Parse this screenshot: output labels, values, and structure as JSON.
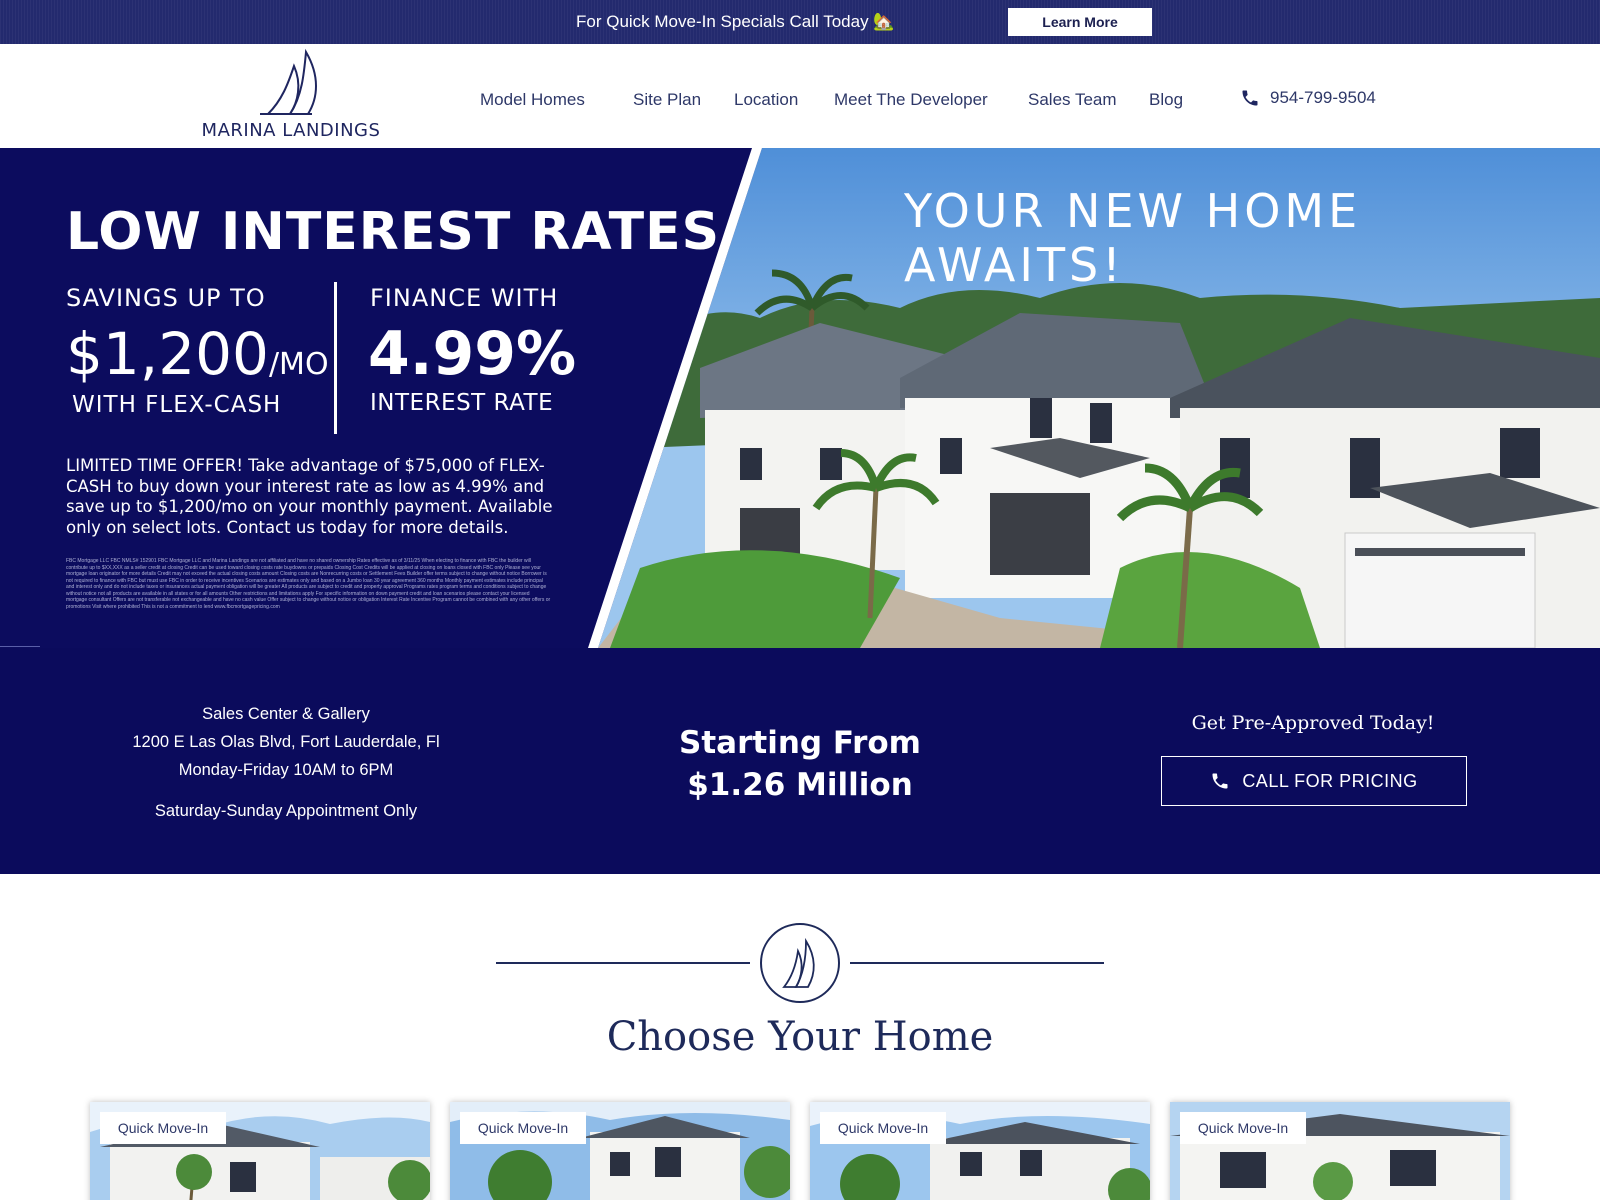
{
  "topbar": {
    "text": "For Quick Move-In Specials Call Today 🏡",
    "button": "Learn More"
  },
  "logo": {
    "text": "MARINA LANDINGS"
  },
  "nav": [
    "Model Homes",
    "Site Plan",
    "Location",
    "Meet The Developer",
    "Sales Team",
    "Blog"
  ],
  "phone": "954-799-9504",
  "hero": {
    "title": "LOW INTEREST RATES",
    "savings": {
      "label": "SAVINGS UP TO",
      "value": "$1,200",
      "unit": "/MO",
      "sub": "WITH FLEX-CASH"
    },
    "finance": {
      "label": "FINANCE WITH",
      "value": "4.99%",
      "sub": "INTEREST RATE"
    },
    "offer": "LIMITED TIME OFFER! Take advantage of $75,000 of FLEX-CASH to buy down your interest rate as low as 4.99% and save up to $1,200/mo on your monthly payment. Available only on select lots. Contact us today for more details.",
    "fine_print": "FBC Mortgage LLC FBC NMLS# 152901 FBC Mortgage LLC and Marina Landings are not affiliated and have no shared ownership Rates effective as of 3/11/25 When electing to finance with FBC the builder will contribute up to $XX,XXX as a seller credit at closing Credit can be used toward closing costs rate buydowns or prepaids Closing Cost Credits will be applied at closing on loans closed with FBC only Please see your mortgage loan originator for more details Credit may not exceed the actual closing costs amount Closing costs are Nonrecurring costs or Settlement Fees Builder offer terms subject to change without notice Borrower is not required to finance with FBC but must use FBC in order to receive incentives Scenarios are estimates only and based on a Jumbo loan 30 year agreement 360 months Monthly payment estimates include principal and interest only and do not include taxes or insurances actual payment obligation will be greater All products are subject to credit and property approval Programs rates program terms and conditions subject to change without notice not all products are available in all states or for all amounts Other restrictions and limitations apply For specific information on down payment credit and loan scenarios please contact your licensed mortgage consultant Offers are not transferable not exchangeable and have no cash value Offer subject to change without notice or obligation Interest Rate Incentive Program cannot be combined with any other offers or promotions Visit where prohibited This is not a commitment to lend www.fbcmortgagepricing.com",
    "tagline": "YOUR NEW HOME AWAITS!"
  },
  "info": {
    "sales_center": "Sales Center & Gallery",
    "address": "1200 E Las Olas Blvd, Fort Lauderdale, Fl",
    "hours": "Monday-Friday 10AM to 6PM",
    "weekend": "Saturday-Sunday Appointment Only",
    "starting_label": "Starting From",
    "starting_price": "$1.26 Million",
    "preapproved": "Get Pre-Approved Today!",
    "call_button": "CALL FOR PRICING"
  },
  "section": {
    "title": "Choose Your Home"
  },
  "cards": [
    {
      "badge": "Quick Move-In"
    },
    {
      "badge": "Quick Move-In"
    },
    {
      "badge": "Quick Move-In"
    },
    {
      "badge": "Quick Move-In"
    }
  ],
  "colors": {
    "navy": "#0c0c5e",
    "topbar": "#232a6e",
    "text_dark": "#1e2a5a"
  },
  "icons": {
    "phone": "phone-icon",
    "logo": "sailboat-icon"
  }
}
